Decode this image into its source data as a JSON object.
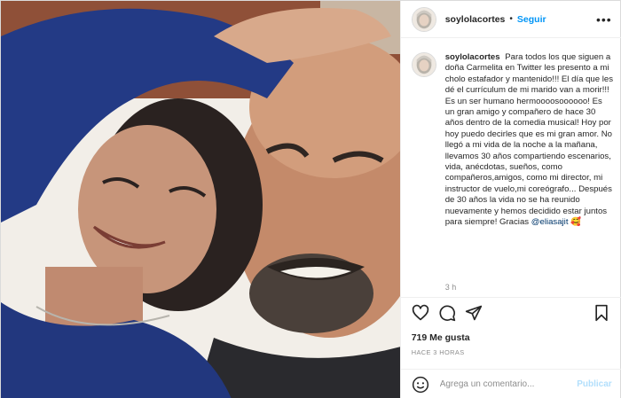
{
  "colors": {
    "link": "#0095f6",
    "mention": "#00376b",
    "muted": "#8e8e8e",
    "publish_disabled": "#b2dffc"
  },
  "post": {
    "username": "soylolacortes",
    "separator": "•",
    "follow_label": "Seguir",
    "more_icon": "more-horizontal-icon",
    "caption": {
      "username": "soylolacortes",
      "text": "Para todos los que siguen a doña Carmelita en Twitter les presento a mi cholo estafador y mantenido!!! El día que les dé el currículum de mi marido van a morir!!! Es un ser humano hermoooosoooooo! Es un gran amigo y compañero de hace 30 años dentro de la comedia musical! Hoy por hoy puedo decirles que es mi gran amor. No llegó a mi vida de la noche a la mañana, llevamos 30 años compartiendo escenarios, vida, anécdotas, sueños, como compañeros,amigos, como mi director, mi instructor de vuelo,mi coreógrafo... Después de 30 años la vida no se ha reunido nuevamente y hemos decidido estar juntos para siempre! Gracias",
      "mention": "@eliasajit",
      "emoji": "🥰"
    },
    "caption_time": "3 h",
    "actions": {
      "like_icon": "heart-icon",
      "comment_icon": "comment-icon",
      "share_icon": "share-icon",
      "save_icon": "bookmark-icon"
    },
    "likes": "719 Me gusta",
    "time_ago": "HACE 3 HORAS",
    "comment": {
      "emoji_icon": "emoji-icon",
      "placeholder": "Agrega un comentario...",
      "publish_label": "Publicar"
    }
  }
}
